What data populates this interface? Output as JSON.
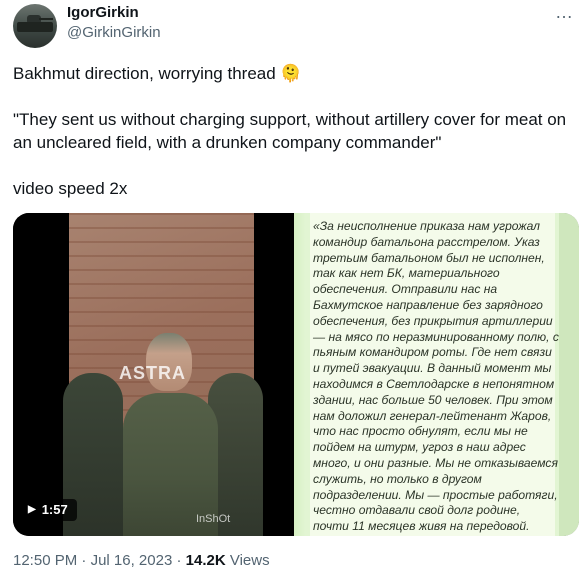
{
  "author": {
    "name": "IgorGirkin",
    "handle": "@GirkinGirkin",
    "avatar_icon": "tank-avatar"
  },
  "more_icon": "…",
  "tweet": {
    "line1": "Bakhmut direction, worrying thread 🫠",
    "line2": "\"They sent us without charging support, without artillery cover for meat on an uncleared field, with a drunken company commander\"",
    "line3": "video speed 2x"
  },
  "video": {
    "duration": "1:57",
    "watermark": "ASTRA",
    "app_mark": "InShOt"
  },
  "image_text": "«За неисполнение приказа нам угрожал командир батальона расстрелом. Указ третьим батальоном был не исполнен, так как нет БК, материального обеспечения. Отправили нас на Бахмутское направление без зарядного обеспечения, без прикрытия артиллерии — на мясо по неразминированному полю, с пьяным командиром роты. Где нет связи и путей эвакуации. В данный момент мы находимся в Светлодарске в непонятном здании, нас больше 50 человек. При этом нам доложил генерал-лейтенант Жаров, что нас просто обнулят, если мы не пойдем на штурм, угроз в наш адрес много, и они разные. Мы не отказываемся служить, но только в другом подразделении. Мы — простые работяги, честно отдавали свой долг родине, почти 11 месяцев живя на передовой. Просим привлечь к ответственности лиц, причастных к несоблюдению прав",
  "meta": {
    "time": "12:50 PM",
    "sep1": "·",
    "date": "Jul 16, 2023",
    "sep2": "·",
    "views_count": "14.2K",
    "views_label": "Views"
  }
}
